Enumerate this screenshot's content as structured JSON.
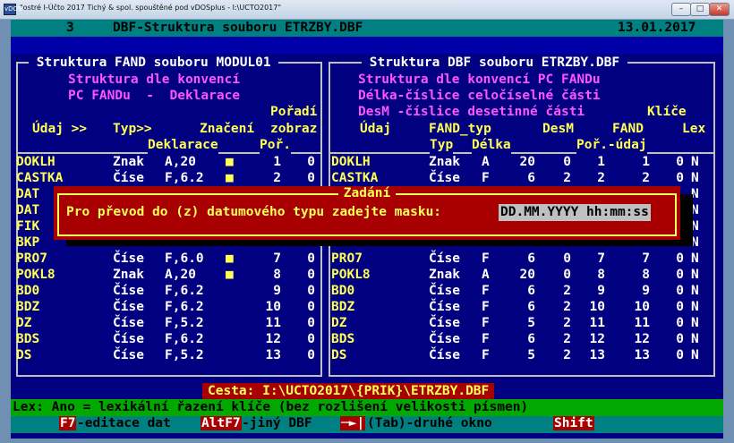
{
  "window": {
    "title": "\"ostré I-Účto 2017 Tichý & spol. spouštěné pod vDOSplus - I:\\UCTO2017\"",
    "icon_text": "vDOS",
    "min_label": "–",
    "max_label": "□",
    "close_label": "✕"
  },
  "header": {
    "number": "3",
    "title": "DBF-Struktura souboru ETRZBY.DBF",
    "date": "13.01.2017"
  },
  "left_panel": {
    "title": " Struktura FAND souboru MODUL01 ",
    "conv1": "Struktura dle konvencí",
    "conv2": "PC FANDu  -  Deklarace",
    "col_poradi": "Pořadí",
    "col_udaj": "Údaj >>",
    "col_typ": "Typ>>",
    "col_znaceni": "Značení",
    "col_zobraz": "zobraz",
    "sub_deklarace": "Deklarace",
    "sub_por": "Poř.",
    "rows": [
      {
        "name": "DOKLH",
        "type": "Znak",
        "decl": "A,20",
        "mark": "■",
        "por": "1",
        "zob": "0"
      },
      {
        "name": "CASTKA",
        "type": "Číse",
        "decl": "F,6.2",
        "mark": "■",
        "por": "2",
        "zob": "0"
      },
      {
        "name": "DAT",
        "type": "",
        "decl": "",
        "mark": "",
        "por": "",
        "zob": ""
      },
      {
        "name": "DAT",
        "type": "",
        "decl": "",
        "mark": "",
        "por": "",
        "zob": ""
      },
      {
        "name": "FIK",
        "type": "",
        "decl": "",
        "mark": "",
        "por": "",
        "zob": ""
      },
      {
        "name": "BKP",
        "type": "",
        "decl": "",
        "mark": "",
        "por": "",
        "zob": ""
      },
      {
        "name": "PRO7",
        "type": "Číse",
        "decl": "F,6.0",
        "mark": "■",
        "por": "7",
        "zob": "0"
      },
      {
        "name": "POKL8",
        "type": "Znak",
        "decl": "A,20",
        "mark": "■",
        "por": "8",
        "zob": "0"
      },
      {
        "name": "BD0",
        "type": "Číse",
        "decl": "F,6.2",
        "mark": "",
        "por": "9",
        "zob": "0"
      },
      {
        "name": "BDZ",
        "type": "Číse",
        "decl": "F,6.2",
        "mark": "",
        "por": "10",
        "zob": "0"
      },
      {
        "name": "DZ",
        "type": "Číse",
        "decl": "F,5.2",
        "mark": "",
        "por": "11",
        "zob": "0"
      },
      {
        "name": "BDS",
        "type": "Číse",
        "decl": "F,6.2",
        "mark": "",
        "por": "12",
        "zob": "0"
      },
      {
        "name": "DS",
        "type": "Číse",
        "decl": "F,5.2",
        "mark": "",
        "por": "13",
        "zob": "0"
      }
    ]
  },
  "right_panel": {
    "title": " Struktura DBF souboru ETRZBY.DBF ",
    "conv1": "Struktura dle konvencí PC FANDu",
    "conv2": "Délka-číslice celočíselné části",
    "conv3": "DesM -číslice desetinné části",
    "col_klice": "Klíče",
    "col_udaj": "Údaj",
    "col_fandtyp": "FAND_typ",
    "col_desm": "DesM",
    "col_fand": "FAND",
    "col_lex": "Lex",
    "sub_typ": "Typ",
    "sub_delka": "Délka",
    "sub_por_udaj": "Poř.-údaj",
    "rows": [
      {
        "name": "DOKLH",
        "type": "Znak",
        "ft": "A",
        "len": "20",
        "dec": "0",
        "por": "1",
        "fand": "1",
        "k": "0",
        "lex": "N"
      },
      {
        "name": "CASTKA",
        "type": "Číse",
        "ft": "F",
        "len": "6",
        "dec": "2",
        "por": "2",
        "fand": "2",
        "k": "0",
        "lex": "N"
      },
      {
        "name": "",
        "type": "",
        "ft": "",
        "len": "",
        "dec": "",
        "por": "",
        "fand": "",
        "k": "",
        "lex": "N"
      },
      {
        "name": "",
        "type": "",
        "ft": "",
        "len": "",
        "dec": "",
        "por": "",
        "fand": "",
        "k": "",
        "lex": "N"
      },
      {
        "name": "",
        "type": "",
        "ft": "",
        "len": "",
        "dec": "",
        "por": "",
        "fand": "",
        "k": "",
        "lex": "N"
      },
      {
        "name": "",
        "type": "",
        "ft": "",
        "len": "",
        "dec": "",
        "por": "",
        "fand": "",
        "k": "",
        "lex": "N"
      },
      {
        "name": "PRO7",
        "type": "Číse",
        "ft": "F",
        "len": "6",
        "dec": "0",
        "por": "7",
        "fand": "7",
        "k": "0",
        "lex": "N"
      },
      {
        "name": "POKL8",
        "type": "Znak",
        "ft": "A",
        "len": "20",
        "dec": "0",
        "por": "8",
        "fand": "8",
        "k": "0",
        "lex": "N"
      },
      {
        "name": "BD0",
        "type": "Číse",
        "ft": "F",
        "len": "6",
        "dec": "2",
        "por": "9",
        "fand": "9",
        "k": "0",
        "lex": "N"
      },
      {
        "name": "BDZ",
        "type": "Číse",
        "ft": "F",
        "len": "6",
        "dec": "2",
        "por": "10",
        "fand": "10",
        "k": "0",
        "lex": "N"
      },
      {
        "name": "DZ",
        "type": "Číse",
        "ft": "F",
        "len": "5",
        "dec": "2",
        "por": "11",
        "fand": "11",
        "k": "0",
        "lex": "N"
      },
      {
        "name": "BDS",
        "type": "Číse",
        "ft": "F",
        "len": "6",
        "dec": "2",
        "por": "12",
        "fand": "12",
        "k": "0",
        "lex": "N"
      },
      {
        "name": "DS",
        "type": "Číse",
        "ft": "F",
        "len": "5",
        "dec": "2",
        "por": "13",
        "fand": "13",
        "k": "0",
        "lex": "N"
      }
    ]
  },
  "dialog": {
    "title": "Zadání",
    "prompt": "Pro převod do (z) datumového typu zadejte masku:",
    "value": "DD.MM.YYYY hh:mm:ss"
  },
  "footer": {
    "path": "Cesta: I:\\UCTO2017\\{PRIK}\\ETRZBY.DBF",
    "status": "Lex: Ano = lexikální řazení klíče (bez rozlišení velikosti písmen)",
    "keys": [
      {
        "key": "F7",
        "label": "-editace dat"
      },
      {
        "key": "AltF7",
        "label": "-jiný DBF"
      },
      {
        "key": "─►|",
        "label": "(Tab)-druhé okno"
      },
      {
        "key": "Shift",
        "label": ""
      }
    ]
  },
  "colors": {
    "background": "#000080",
    "header_bar": "#008080",
    "dialog": "#a80000",
    "status_bar": "#00a800"
  }
}
